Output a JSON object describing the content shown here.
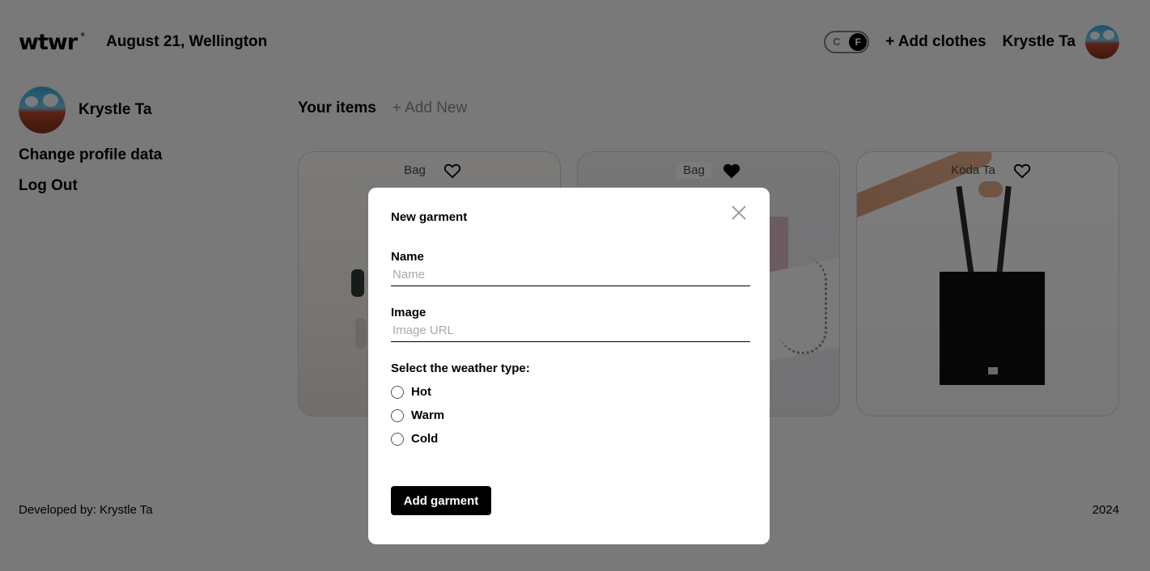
{
  "header": {
    "logo": "wtwr",
    "date_location": "August 21, Wellington",
    "toggle": {
      "left": "C",
      "right": "F",
      "active": "F"
    },
    "add_clothes": "+ Add clothes",
    "username": "Krystle Ta"
  },
  "sidebar": {
    "name": "Krystle Ta",
    "links": [
      "Change profile data",
      "Log Out"
    ]
  },
  "items": {
    "title": "Your items",
    "add_new": "+ Add New",
    "cards": [
      {
        "label": "Bag",
        "liked": false
      },
      {
        "label": "Bag",
        "liked": true
      },
      {
        "label": "Koda Ta",
        "liked": false
      }
    ]
  },
  "footer": {
    "developer": "Developed by: Krystle Ta",
    "year": "2024"
  },
  "modal": {
    "title": "New garment",
    "name_label": "Name",
    "name_placeholder": "Name",
    "image_label": "Image",
    "image_placeholder": "Image URL",
    "weather_label": "Select the weather type:",
    "weather_options": [
      "Hot",
      "Warm",
      "Cold"
    ],
    "submit": "Add garment"
  }
}
